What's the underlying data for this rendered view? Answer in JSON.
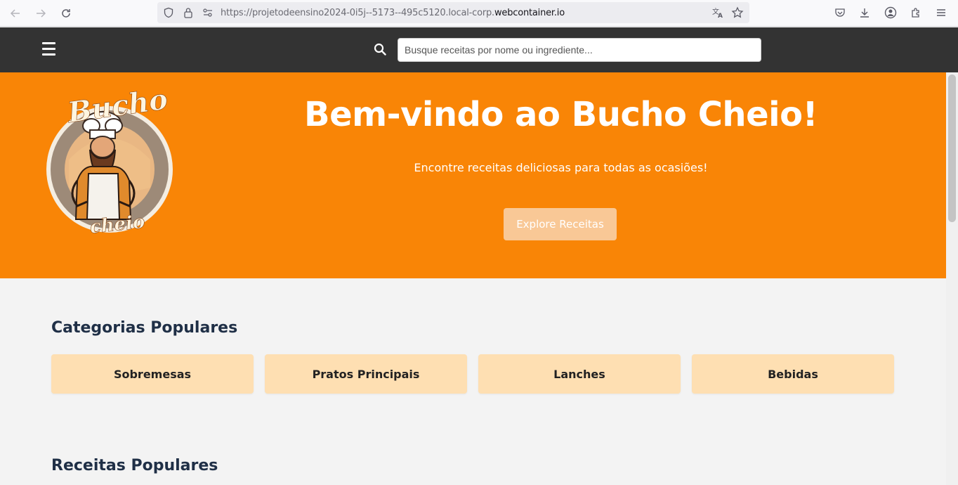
{
  "browser": {
    "url_prefix": "https://projetodeensino2024-0i5j--5173--495c5120.local-corp.",
    "url_domain": "webcontainer.io"
  },
  "header": {
    "search_placeholder": "Busque receitas por nome ou ingrediente..."
  },
  "hero": {
    "logo_text_top": "Bucho",
    "logo_text_bottom": "cheio",
    "title": "Bem-vindo ao Bucho Cheio!",
    "subtitle": "Encontre receitas deliciosas para todas as ocasiões!",
    "cta_label": "Explore Receitas"
  },
  "categories": {
    "title": "Categorias Populares",
    "items": [
      "Sobremesas",
      "Pratos Principais",
      "Lanches",
      "Bebidas"
    ]
  },
  "recipes": {
    "title": "Receitas Populares"
  },
  "colors": {
    "header_bg": "#333333",
    "hero_bg": "#f98506",
    "card_bg": "#fedfb2",
    "title_color": "#1f2f46"
  }
}
